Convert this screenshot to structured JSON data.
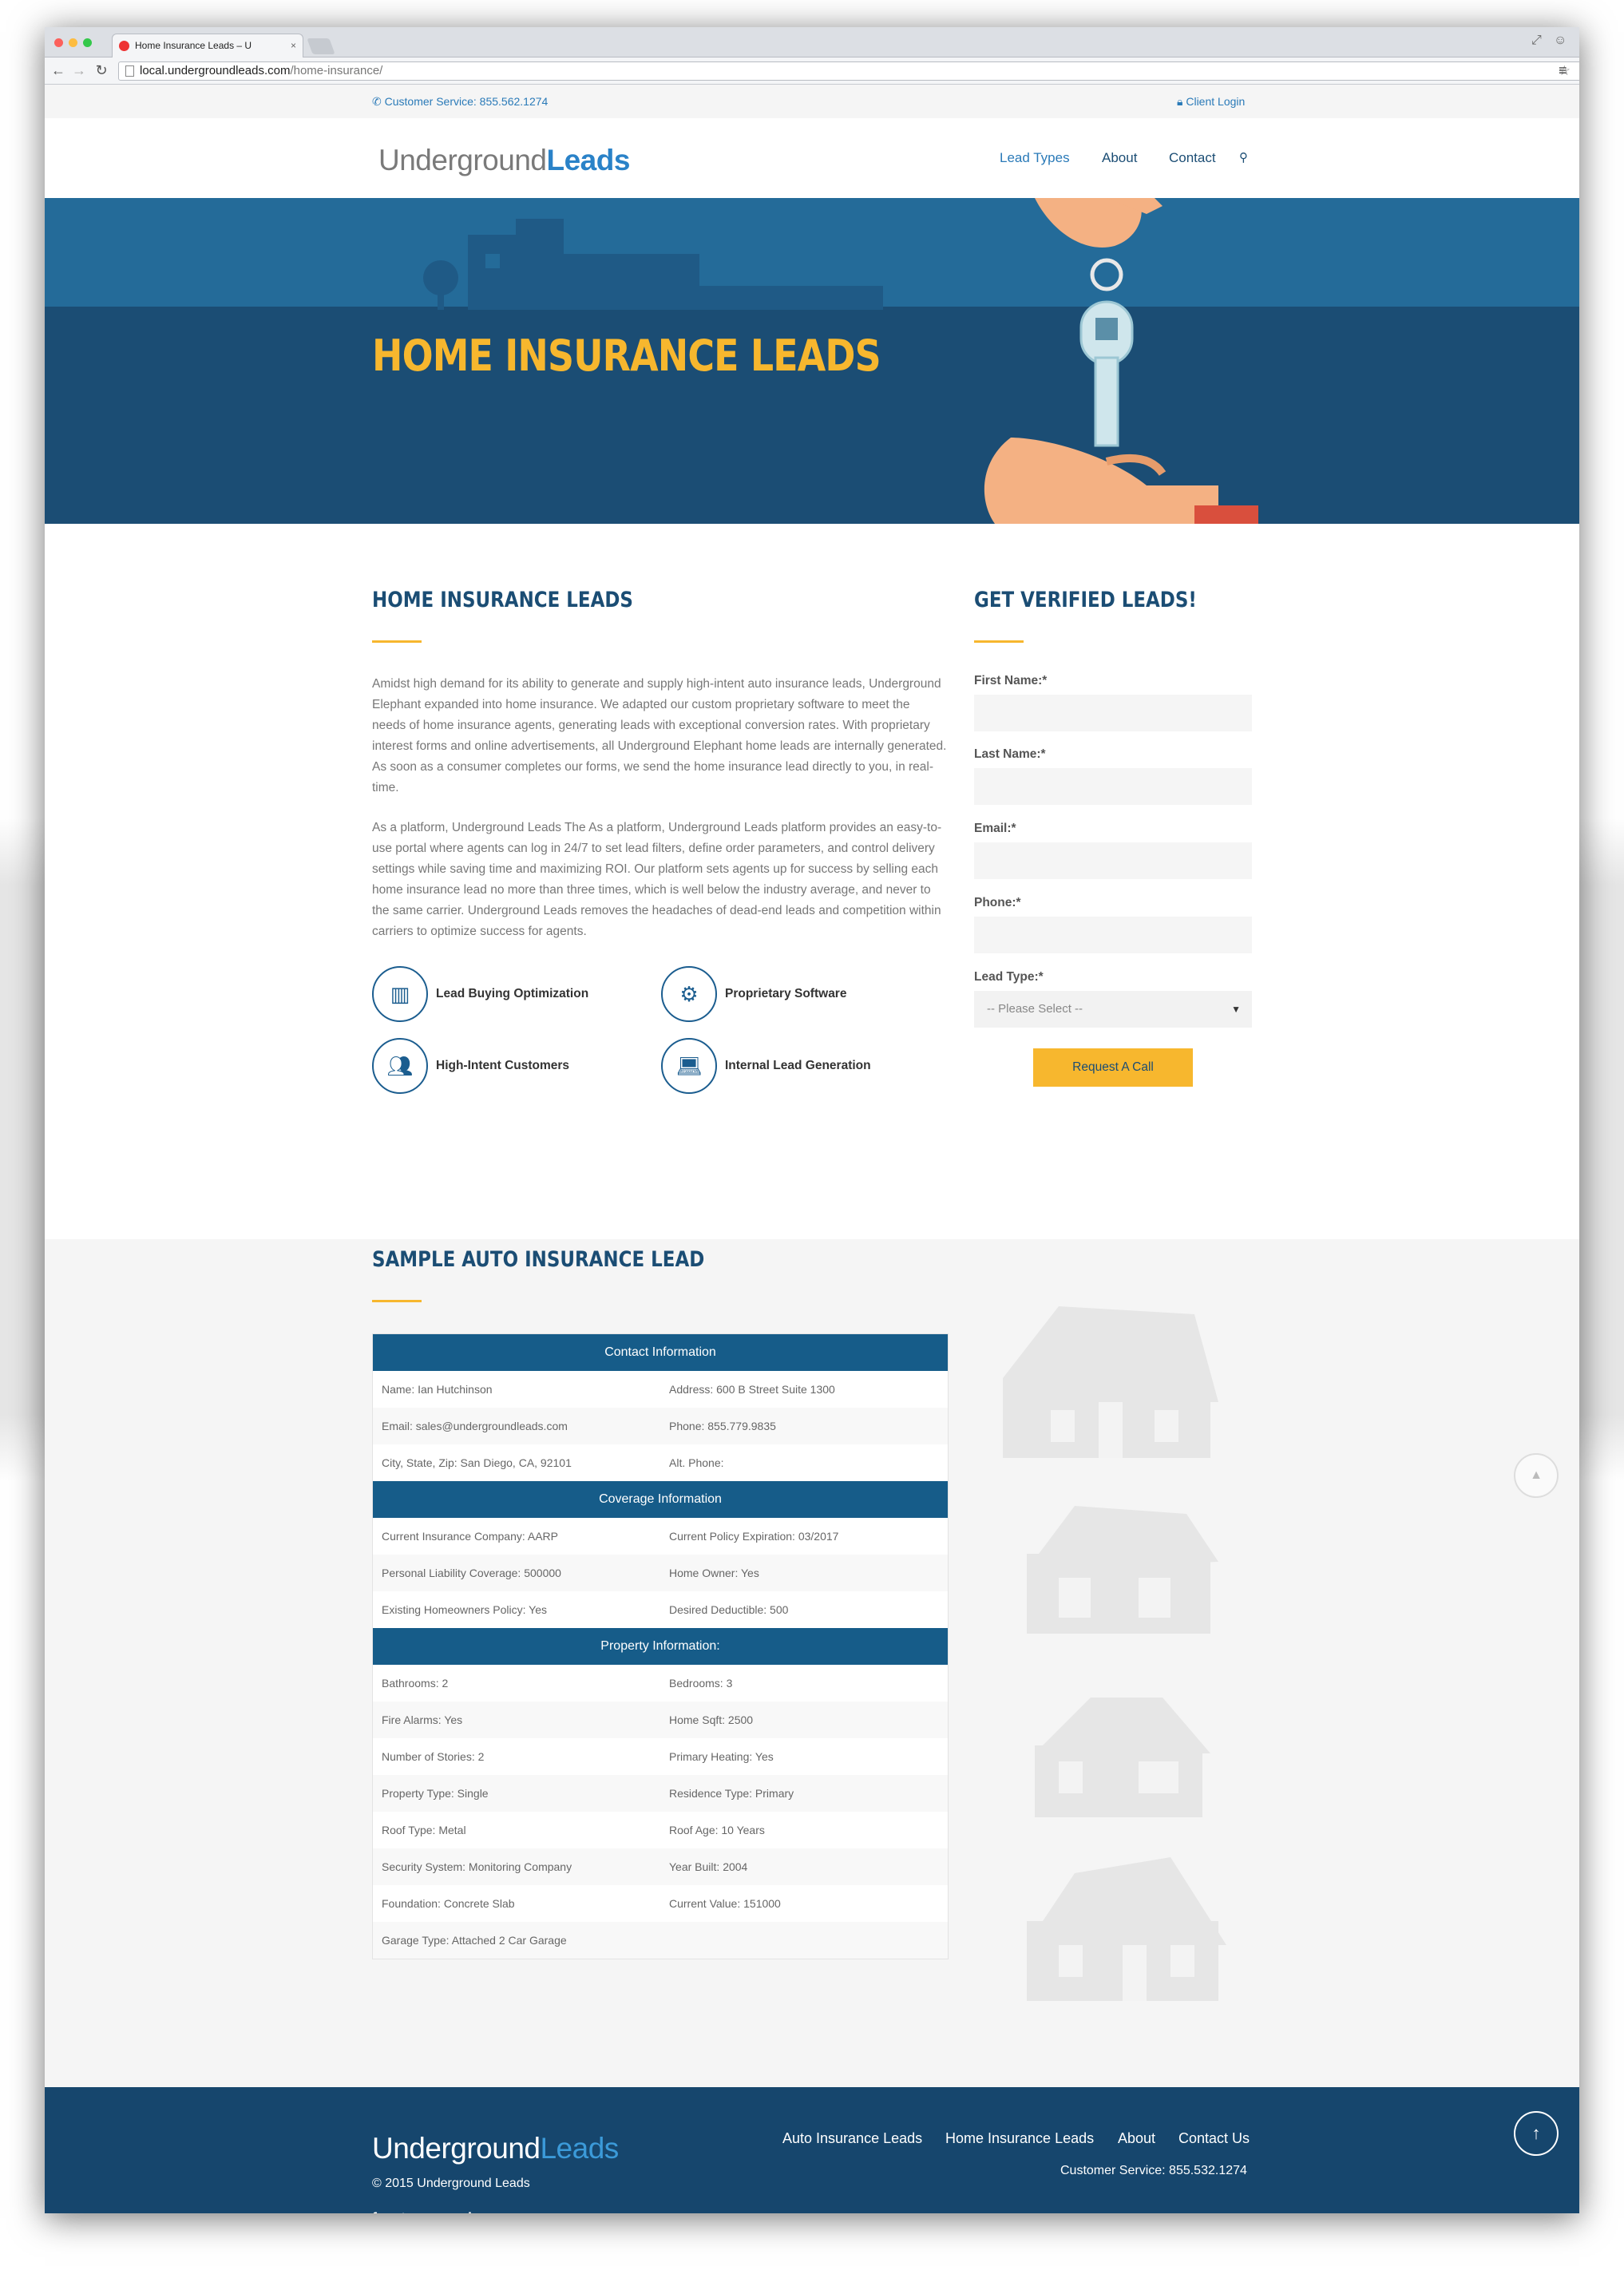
{
  "browser": {
    "tab_title": "Home Insurance Leads – U",
    "tab_close": "×",
    "url_host": "local.undergroundleads.com",
    "url_path": "/home-insurance/"
  },
  "topbar": {
    "customer_service": "Customer Service: 855.562.1274",
    "client_login": "Client Login"
  },
  "header": {
    "logo_part1": "Underground",
    "logo_part2": "Leads",
    "nav": [
      "Lead Types",
      "About",
      "Contact"
    ]
  },
  "hero": {
    "title": "HOME INSURANCE LEADS"
  },
  "main": {
    "heading": "HOME INSURANCE LEADS",
    "paragraph1": "Amidst high demand for its ability to generate and supply high-intent auto insurance leads, Underground Elephant expanded into home insurance. We adapted our custom proprietary software to meet the needs of home insurance agents, generating leads with exceptional conversion rates. With proprietary interest forms and online advertisements, all Underground Elephant home leads are internally generated. As soon as a consumer completes our forms, we send the home insurance lead directly to you, in real-time.",
    "paragraph2": "As a platform, Underground Leads The As a platform, Underground Leads platform provides an easy-to-use portal where agents can log in  24/7 to set lead filters, define order parameters, and control delivery settings while saving time and maximizing ROI. Our platform sets agents up for success by selling each home insurance lead no more than three times, which is well below the industry average, and never to the same carrier. Underground Leads removes the headaches of dead-end leads and competition within carriers to optimize success for agents.",
    "features": [
      {
        "label": "Lead Buying Optimization",
        "icon": "bar-chart-icon"
      },
      {
        "label": "Proprietary Software",
        "icon": "gears-icon"
      },
      {
        "label": "High-Intent Customers",
        "icon": "users-icon"
      },
      {
        "label": "Internal Lead Generation",
        "icon": "laptop-icon"
      }
    ]
  },
  "form": {
    "heading": "GET VERIFIED LEADS!",
    "first_name_label": "First Name:*",
    "last_name_label": "Last Name:*",
    "email_label": "Email:*",
    "phone_label": "Phone:*",
    "lead_type_label": "Lead Type:*",
    "lead_type_selected": "-- Please Select --",
    "submit_label": "Request A Call"
  },
  "sample": {
    "heading": "SAMPLE AUTO INSURANCE LEAD",
    "sections": [
      {
        "title": "Contact Information",
        "rows": [
          [
            "Name: Ian Hutchinson",
            "Address: 600 B Street Suite 1300"
          ],
          [
            "Email: sales@undergroundleads.com",
            "Phone: 855.779.9835"
          ],
          [
            "City, State, Zip: San Diego, CA, 92101",
            "Alt. Phone:"
          ]
        ]
      },
      {
        "title": "Coverage Information",
        "rows": [
          [
            "Current Insurance Company: AARP",
            "Current Policy Expiration: 03/2017"
          ],
          [
            "Personal Liability Coverage: 500000",
            "Home Owner: Yes"
          ],
          [
            "Existing Homeowners Policy: Yes",
            "Desired Deductible: 500"
          ]
        ]
      },
      {
        "title": "Property Information:",
        "rows": [
          [
            "Bathrooms: 2",
            "Bedrooms: 3"
          ],
          [
            "Fire Alarms: Yes",
            "Home Sqft: 2500"
          ],
          [
            "Number of Stories: 2",
            "Primary Heating: Yes"
          ],
          [
            "Property Type: Single",
            "Residence Type: Primary"
          ],
          [
            "Roof Type: Metal",
            "Roof Age: 10 Years"
          ],
          [
            "Security System: Monitoring Company",
            "Year Built: 2004"
          ],
          [
            "Foundation: Concrete Slab",
            "Current Value: 151000"
          ],
          [
            "Garage Type: Attached 2 Car Garage",
            ""
          ]
        ]
      }
    ]
  },
  "footer": {
    "logo_part1": "Underground",
    "logo_part2": "Leads",
    "copyright": "© 2015 Underground Leads",
    "links": [
      "Auto Insurance Leads",
      "Home Insurance Leads",
      "About",
      "Contact Us"
    ],
    "customer_service": "Customer Service: 855.532.1274",
    "social": [
      "f",
      "t",
      "g+",
      "in"
    ]
  },
  "colors": {
    "brand_blue": "#1b4d74",
    "accent_yellow": "#f7b72e",
    "link_blue": "#2a7ab8"
  }
}
